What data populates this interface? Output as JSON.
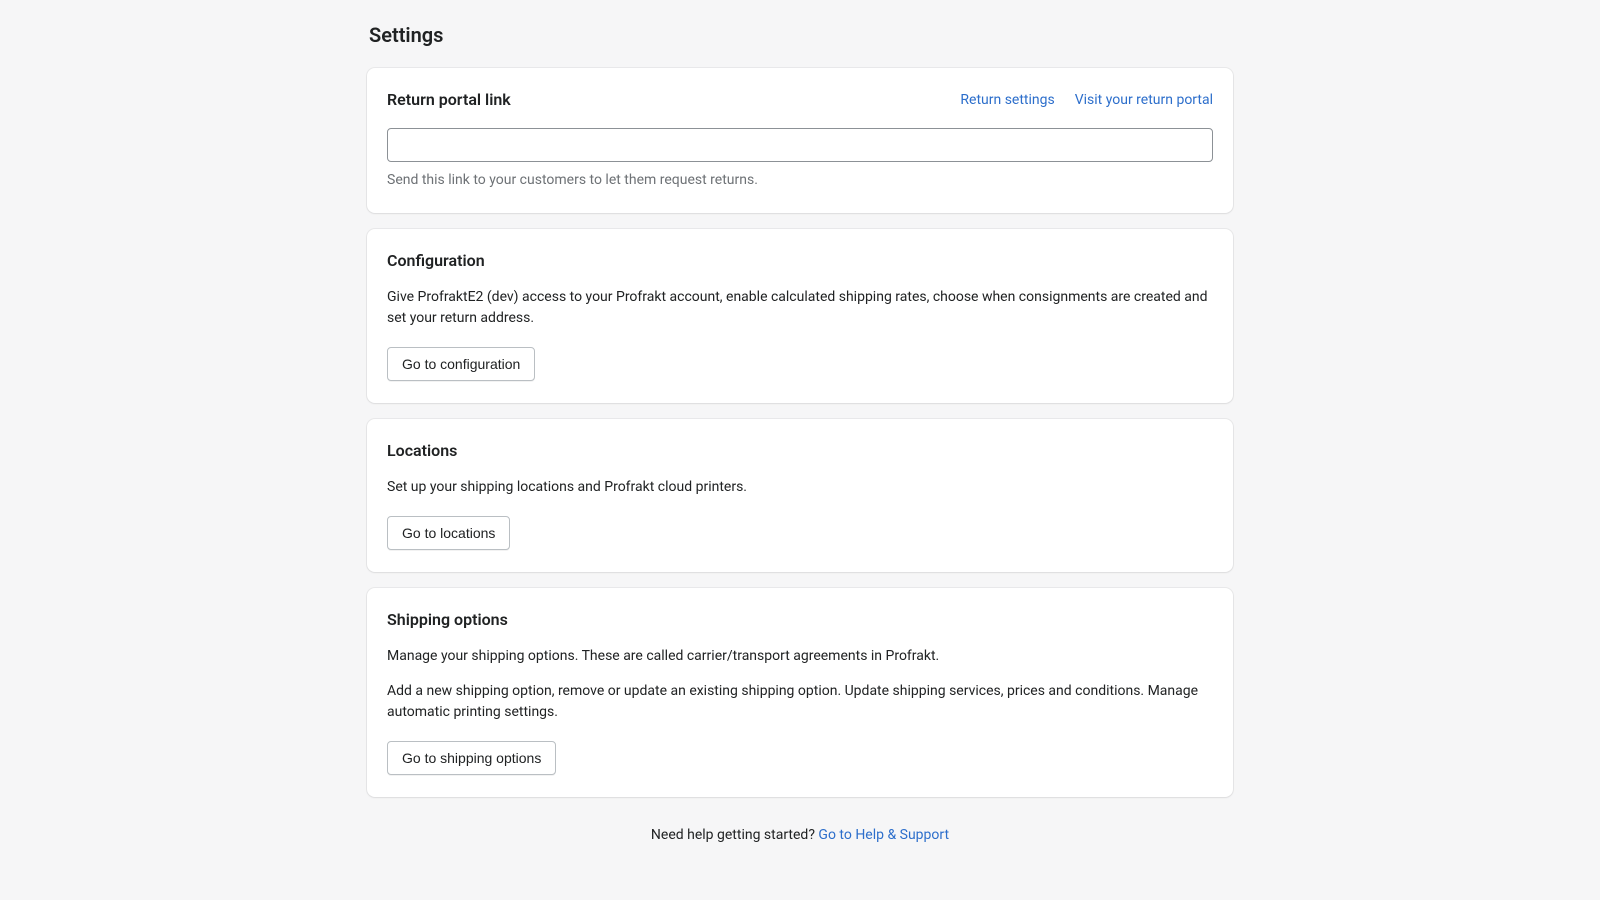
{
  "page": {
    "title": "Settings"
  },
  "return_portal": {
    "title": "Return portal link",
    "links": {
      "return_settings": "Return settings",
      "visit_portal": "Visit your return portal"
    },
    "input_value": "",
    "help_text": "Send this link to your customers to let them request returns."
  },
  "configuration": {
    "title": "Configuration",
    "description": "Give ProfraktE2 (dev) access to your Profrakt account, enable calculated shipping rates, choose when consignments are created and set your return address.",
    "button": "Go to configuration"
  },
  "locations": {
    "title": "Locations",
    "description": "Set up your shipping locations and Profrakt cloud printers.",
    "button": "Go to locations"
  },
  "shipping_options": {
    "title": "Shipping options",
    "description_1": "Manage your shipping options. These are called carrier/transport agreements in Profrakt.",
    "description_2": "Add a new shipping option, remove or update an existing shipping option. Update shipping services, prices and conditions. Manage automatic printing settings.",
    "button": "Go to shipping options"
  },
  "footer": {
    "prompt": "Need help getting started? ",
    "link": "Go to Help & Support"
  }
}
